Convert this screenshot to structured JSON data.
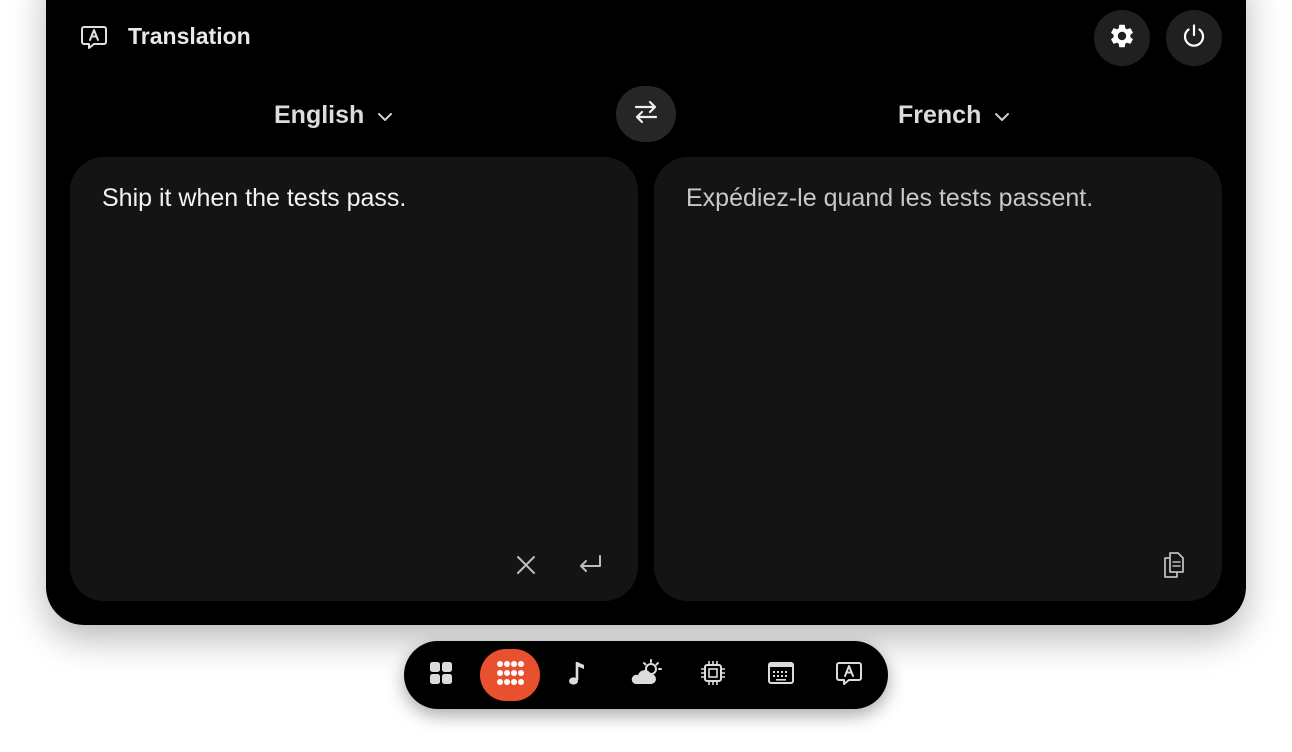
{
  "header": {
    "title": "Translation",
    "icons": [
      "translate-bubble-icon",
      "gear-icon",
      "power-icon"
    ]
  },
  "languages": {
    "source": "English",
    "target": "French",
    "swap_icon": "swap-arrows-icon"
  },
  "input": {
    "text": "Ship it when the tests pass.",
    "icons": [
      "close-icon",
      "return-icon"
    ]
  },
  "output": {
    "text": "Expédiez-le quand les tests passent.",
    "icons": [
      "copy-icon"
    ]
  },
  "dock": {
    "items": [
      "widgets-grid-icon",
      "apps-grid-icon",
      "music-note-icon",
      "weather-icon",
      "cpu-icon",
      "keyboard-icon",
      "translate-bubble-icon"
    ],
    "active_index": 1,
    "accent": "#e8502f"
  },
  "colors": {
    "panel_bg": "#000000",
    "card_bg": "#141414",
    "button_bg": "#202020"
  }
}
